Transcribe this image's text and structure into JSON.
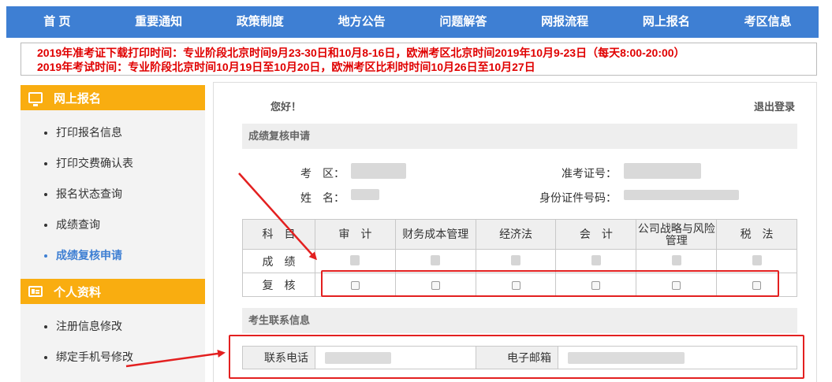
{
  "nav": {
    "items": [
      "首 页",
      "重要通知",
      "政策制度",
      "地方公告",
      "问题解答",
      "网报流程",
      "网上报名",
      "考区信息"
    ]
  },
  "notice": {
    "line1": "2019年准考证下载打印时间：专业阶段北京时间9月23-30日和10月8-16日，欧洲考区北京时间2019年10月9-23日（每天8:00-20:00）",
    "line2": "2019年考试时间：专业阶段北京时间10月19日至10月20日，欧洲考区比利时时间10月26日至10月27日"
  },
  "sidebar": {
    "section1": {
      "title": "网上报名",
      "icon": "monitor-icon",
      "items": [
        "打印报名信息",
        "打印交费确认表",
        "报名状态查询",
        "成绩查询",
        "成绩复核申请"
      ],
      "active_index": 4
    },
    "section2": {
      "title": "个人资料",
      "icon": "id-card-icon",
      "items": [
        "注册信息修改",
        "绑定手机号修改"
      ]
    }
  },
  "main": {
    "greeting": "您好！",
    "logout": "退出登录",
    "section_title": "成绩复核申请",
    "info": {
      "exam_area_label": "考　区：",
      "name_label": "姓　名：",
      "admission_label": "准考证号：",
      "id_label": "身份证件号码："
    },
    "table": {
      "subject_header": "科　目",
      "subjects": [
        "审　计",
        "财务成本管理",
        "经济法",
        "会　计",
        "公司战略与风险管理",
        "税　法"
      ],
      "score_row_label": "成　绩",
      "review_row_label": "复　核"
    },
    "contact_section_title": "考生联系信息",
    "contact": {
      "phone_label": "联系电话",
      "email_label": "电子邮箱"
    }
  },
  "colors": {
    "nav_bg": "#3e7fd3",
    "sidebar_header": "#f9ad10",
    "notice_text": "#e00000",
    "annotation_red": "#e32020"
  }
}
